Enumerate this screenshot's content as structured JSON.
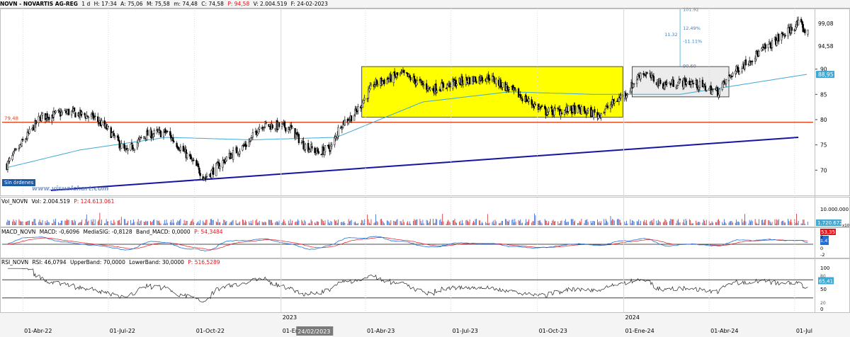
{
  "header": {
    "symbol": "NOVN - NOVARTIS AG-REG",
    "interval": "1 d",
    "hour": "H: 17:34",
    "open": "A: 75,06",
    "high": "M: 75,58",
    "low": "m: 74,48",
    "close": "C: 74,58",
    "p": "P: 94,58",
    "volume": "V: 2.004.519",
    "date": "F: 24-02-2023"
  },
  "badges": {
    "sin_ordenes": "Sin órdenes",
    "watermark": "www.visualchart.com",
    "crosshair_date": "24/02/2023"
  },
  "panes": {
    "volume": {
      "name": "Vol_NOVN",
      "vol": "Vol: 2.004.519",
      "p": "P: 124.613.061",
      "tick_top": "10.000.000",
      "tag": "1.720.672",
      "tag_suffix": "x10"
    },
    "macd": {
      "name": "MACD_NOVN",
      "macd": "MACD: -0,6096",
      "signal": "MediaSIG: -0,8128",
      "band": "Band_MACD: 0,0000",
      "p": "P: 54,3484",
      "tag_red": "53,35",
      "tag_blue": "1,47",
      "ticks": [
        "2",
        "0",
        "-2"
      ]
    },
    "rsi": {
      "name": "RSI_NOVN",
      "rsi": "RSI: 46,0794",
      "upper": "UpperBand: 70,0000",
      "lower": "LowerBand: 30,0000",
      "p": "P: 516,5289",
      "tag_value": "65,41",
      "ticks": [
        "100",
        "50",
        "0"
      ],
      "tag_80": "80",
      "tag_20": "20"
    }
  },
  "price_axis": {
    "ticks": [
      "90",
      "85",
      "80",
      "75",
      "70"
    ],
    "tag_current": "94,58",
    "tag_high": "99,08",
    "tag_ma": "88,95"
  },
  "annotations": {
    "level_label": "79,48",
    "fib_labels": [
      "101.92",
      "12.49%",
      "11.32",
      "-11.11%",
      "90.60"
    ]
  },
  "colors": {
    "up": "#000000",
    "down": "#000000",
    "ma": "#3fa9d4",
    "trend": "#1515a0",
    "level": "#e1451c",
    "box": "#ffff00",
    "macd": "#1f6fd6",
    "signal": "#e3151a",
    "rsi": "#222222"
  },
  "chart_data": {
    "type": "line",
    "title": "NOVN - NOVARTIS AG-REG",
    "x_labels": [
      "01-Abr-22",
      "01-Jul-22",
      "01-Oct-22",
      "01-Ene-23",
      "01-Abr-23",
      "01-Jul-23",
      "01-Oct-23",
      "01-Ene-24",
      "01-Abr-24",
      "01-Jul"
    ],
    "year_labels": [
      "2023",
      "2024"
    ],
    "price_keypoints": [
      [
        "2022-03-15",
        71.0
      ],
      [
        "2022-04-20",
        80.5
      ],
      [
        "2022-05-20",
        81.5
      ],
      [
        "2022-06-15",
        80.5
      ],
      [
        "2022-07-01",
        78.0
      ],
      [
        "2022-07-20",
        73.5
      ],
      [
        "2022-08-10",
        77.0
      ],
      [
        "2022-09-01",
        77.5
      ],
      [
        "2022-09-25",
        72.5
      ],
      [
        "2022-10-12",
        68.5
      ],
      [
        "2022-11-05",
        72.5
      ],
      [
        "2022-11-28",
        75.5
      ],
      [
        "2022-12-10",
        79.0
      ],
      [
        "2023-01-10",
        78.5
      ],
      [
        "2023-01-25",
        75.0
      ],
      [
        "2023-02-10",
        73.5
      ],
      [
        "2023-02-24",
        74.58
      ],
      [
        "2023-03-05",
        79.0
      ],
      [
        "2023-03-20",
        81.0
      ],
      [
        "2023-04-10",
        87.0
      ],
      [
        "2023-05-10",
        89.0
      ],
      [
        "2023-06-10",
        86.0
      ],
      [
        "2023-07-10",
        87.5
      ],
      [
        "2023-08-10",
        88.5
      ],
      [
        "2023-09-10",
        85.0
      ],
      [
        "2023-10-10",
        81.5
      ],
      [
        "2023-11-10",
        82.0
      ],
      [
        "2023-12-05",
        81.0
      ],
      [
        "2024-01-05",
        85.5
      ],
      [
        "2024-01-20",
        89.5
      ],
      [
        "2024-02-10",
        87.0
      ],
      [
        "2024-03-10",
        87.5
      ],
      [
        "2024-04-10",
        85.5
      ],
      [
        "2024-04-25",
        89.0
      ],
      [
        "2024-05-15",
        92.0
      ],
      [
        "2024-06-10",
        95.5
      ],
      [
        "2024-07-05",
        99.0
      ],
      [
        "2024-07-15",
        97.0
      ]
    ],
    "ma_keypoints": [
      [
        "2022-03-15",
        70.5
      ],
      [
        "2022-06-01",
        74.0
      ],
      [
        "2022-09-01",
        76.5
      ],
      [
        "2022-12-01",
        76.0
      ],
      [
        "2023-03-01",
        76.5
      ],
      [
        "2023-06-01",
        83.5
      ],
      [
        "2023-09-01",
        85.5
      ],
      [
        "2023-12-01",
        85.0
      ],
      [
        "2024-03-01",
        85.0
      ],
      [
        "2024-07-15",
        89.0
      ]
    ],
    "support_line": {
      "from": [
        "2022-05-01",
        66.0
      ],
      "to": [
        "2024-07-05",
        76.5
      ]
    },
    "horizontal_level": 79.48,
    "boxes": [
      {
        "from": "2023-03-28",
        "to": "2023-12-31",
        "y_low": 80.5,
        "y_high": 90.5,
        "fill": "yellow"
      },
      {
        "from": "2024-01-10",
        "to": "2024-04-22",
        "y_low": 84.5,
        "y_high": 90.5,
        "fill": "gray"
      }
    ],
    "ylim": [
      65,
      102
    ],
    "macd_range": [
      -2.5,
      2.5
    ],
    "rsi_range": [
      0,
      100
    ],
    "rsi_bands": [
      70,
      30
    ]
  }
}
